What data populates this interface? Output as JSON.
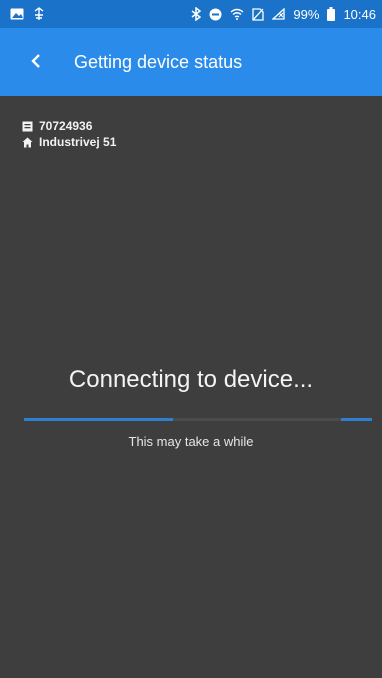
{
  "status_bar": {
    "battery_percent": "99%",
    "time": "10:46",
    "icons": [
      "image-icon",
      "debug-usb-icon",
      "bluetooth-icon",
      "do-not-disturb-icon",
      "wifi-icon",
      "no-sim-icon",
      "signal-icon",
      "battery-icon"
    ]
  },
  "app_bar": {
    "back_icon": "chevron-left-icon",
    "title": "Getting device status"
  },
  "device": {
    "id_icon": "device-box-icon",
    "id": "70724936",
    "address_icon": "home-icon",
    "address": "Industrivej 51"
  },
  "main": {
    "heading": "Connecting to device...",
    "progress": 0.45,
    "subtext": "This may take a while"
  },
  "colors": {
    "status_bar": "#1a72c9",
    "app_bar": "#2a8bea",
    "background": "#3e3e3e",
    "progress": "#2e7fcf"
  }
}
